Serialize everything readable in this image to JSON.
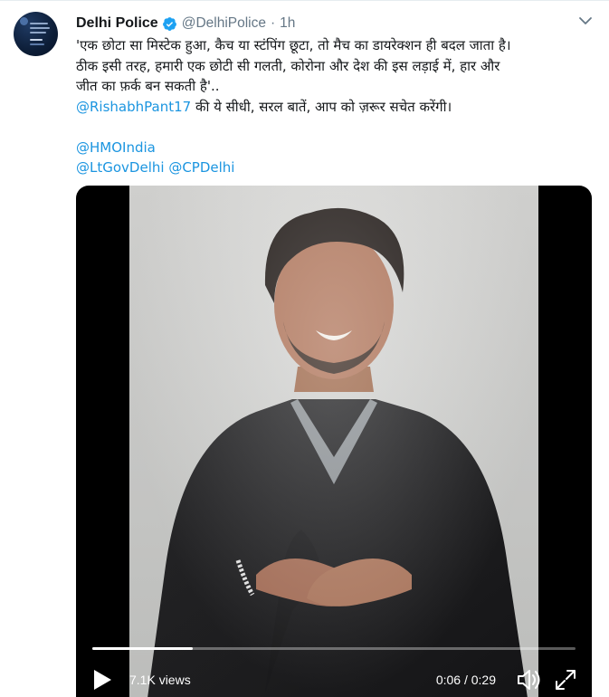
{
  "tweet": {
    "author": {
      "name": "Delhi Police",
      "handle": "@DelhiPolice",
      "verified": true
    },
    "separator": "·",
    "time": "1h",
    "text": {
      "line1": "'एक छोटा सा मिस्टेक हुआ, कैच या स्टंपिंग छूटा, तो मैच का डायरेक्शन ही बदल जाता है।",
      "line2": "ठीक इसी तरह, हमारी एक छोटी सी गलती, कोरोना और देश की इस लड़ाई में, हार और",
      "line3": "जीत का फ़र्क बन सकती है'..",
      "mention_rishabh": "@RishabhPant17",
      "line4_rest": " की ये सीधी, सरल बातें, आप को ज़रूर सचेत करेंगी।",
      "mention_hmo": "@HMOIndia",
      "mention_ltgov": "@LtGovDelhi",
      "mention_cp": "@CPDelhi"
    },
    "video": {
      "views": "7.1K views",
      "current_time": "0:06",
      "time_separator": " / ",
      "duration": "0:29",
      "progress_fraction": 0.207
    }
  },
  "colors": {
    "link": "#1b95e0",
    "verified": "#1da1f2",
    "secondary_text": "#657786",
    "video_bg": "#000000"
  },
  "icons": {
    "verified": "verified-badge-icon",
    "caret": "chevron-down-icon",
    "play": "play-icon",
    "volume": "volume-icon",
    "fullscreen": "fullscreen-icon"
  }
}
